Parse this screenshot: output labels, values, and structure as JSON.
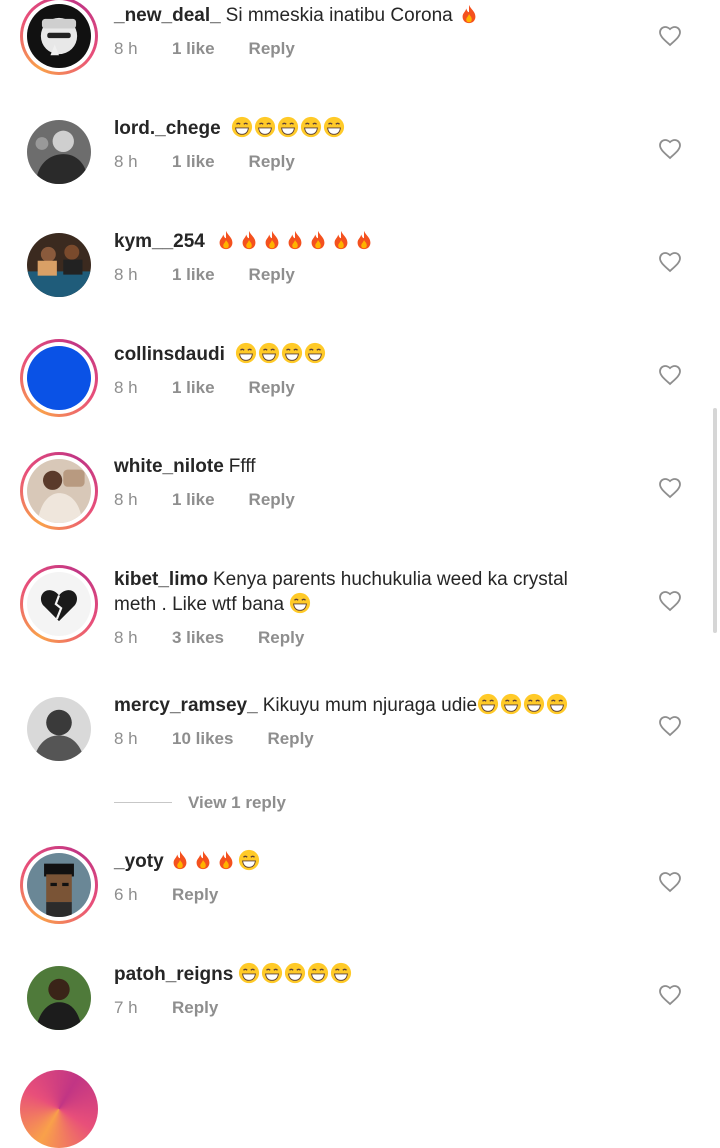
{
  "comments": [
    {
      "username": "_new_deal_",
      "text": "Si mmeskia inatibu Corona",
      "emoji": [
        "fire"
      ],
      "time": "8 h",
      "likes": "1 like",
      "reply": "Reply"
    },
    {
      "username": "lord._chege",
      "text": "",
      "emoji": [
        "grin",
        "grin",
        "grin",
        "grin",
        "grin"
      ],
      "time": "8 h",
      "likes": "1 like",
      "reply": "Reply"
    },
    {
      "username": "kym__254",
      "text": "",
      "emoji": [
        "fire",
        "fire",
        "fire",
        "fire",
        "fire",
        "fire",
        "fire"
      ],
      "time": "8 h",
      "likes": "1 like",
      "reply": "Reply"
    },
    {
      "username": "collinsdaudi",
      "text": "",
      "emoji": [
        "grin",
        "grin",
        "grin",
        "grin"
      ],
      "time": "8 h",
      "likes": "1 like",
      "reply": "Reply"
    },
    {
      "username": "white_nilote",
      "text": "Ffff",
      "emoji": [],
      "time": "8 h",
      "likes": "1 like",
      "reply": "Reply"
    },
    {
      "username": "kibet_limo",
      "text": "Kenya parents huchukulia weed ka crystal",
      "text2": "meth . Like wtf bana",
      "emoji": [
        "grin"
      ],
      "time": "8 h",
      "likes": "3 likes",
      "reply": "Reply"
    },
    {
      "username": "mercy_ramsey_",
      "text": "Kikuyu mum njuraga udie",
      "emoji": [
        "grin",
        "grin",
        "grin",
        "grin"
      ],
      "time": "8 h",
      "likes": "10 likes",
      "reply": "Reply"
    },
    {
      "username": "_yoty",
      "text": "",
      "emoji": [
        "fire",
        "fire",
        "fire",
        "grin"
      ],
      "time": "6 h",
      "likes": "",
      "reply": "Reply"
    },
    {
      "username": "patoh_reigns",
      "text": "",
      "emoji": [
        "grin",
        "grin",
        "grin",
        "grin",
        "grin"
      ],
      "time": "7 h",
      "likes": "",
      "reply": "Reply"
    }
  ],
  "view_replies_label": "View 1 reply",
  "colors": {
    "text": "#262626",
    "meta": "#8e8e8e",
    "ring_start": "#f9a14a",
    "ring_end": "#c13584",
    "collins_avatar": "#0a52e6"
  }
}
